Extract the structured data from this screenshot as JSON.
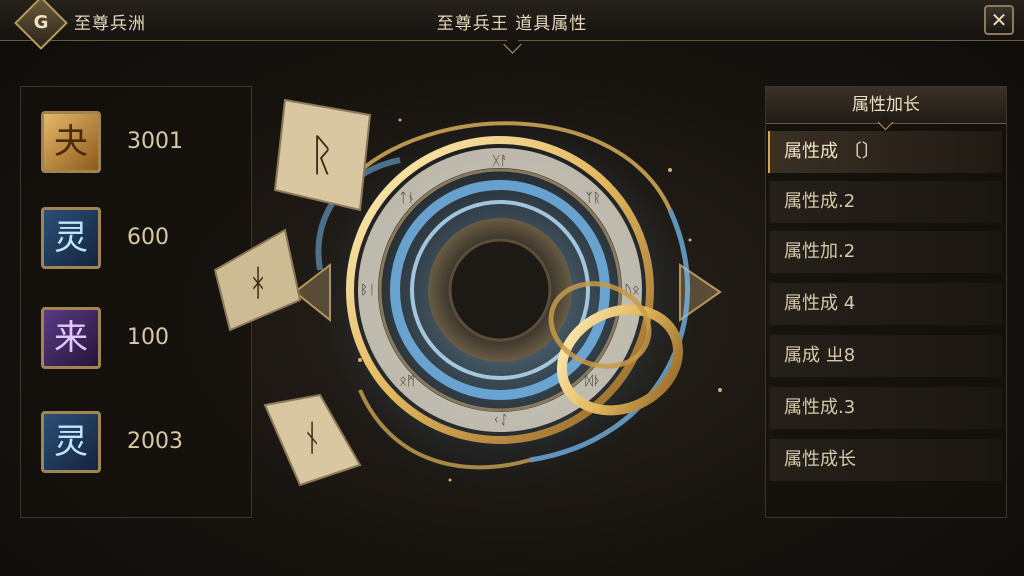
{
  "header": {
    "back_icon_glyph": "G",
    "left_title": "至尊兵洲",
    "center_title": "至尊兵王 道具属性",
    "close_glyph": "✕"
  },
  "resources": [
    {
      "glyph": "夬",
      "value": "3001",
      "style": "gold"
    },
    {
      "glyph": "灵",
      "value": "600",
      "style": "blue"
    },
    {
      "glyph": "来",
      "value": "100",
      "style": "purple"
    },
    {
      "glyph": "灵",
      "value": "2003",
      "style": "blue"
    }
  ],
  "attributes_panel": {
    "header": "属性加长",
    "items": [
      {
        "label": "属性成 〔〕",
        "active": true
      },
      {
        "label": "属性成.2",
        "active": false
      },
      {
        "label": "属性加.2",
        "active": false
      },
      {
        "label": "属性成 4",
        "active": false
      },
      {
        "label": "属成 ㄓ8",
        "active": false
      },
      {
        "label": "属性成.3",
        "active": false
      },
      {
        "label": "属性成长",
        "active": false
      }
    ]
  },
  "artwork": {
    "runes": [
      "ᚱ",
      "ᚼ",
      "ᚾ"
    ],
    "ring_glyphs": [
      "ᚷᚨ",
      "ᛉᚱ",
      "ᚢᛟ",
      "ᛞᚦ",
      "ᚲᛇ",
      "ᛟᛗ",
      "ᛒᛁ",
      "ᛏᚾ"
    ],
    "colors": {
      "gold": "#e2b65c",
      "blue": "#7cc6ff",
      "dark": "#1a1612"
    }
  }
}
